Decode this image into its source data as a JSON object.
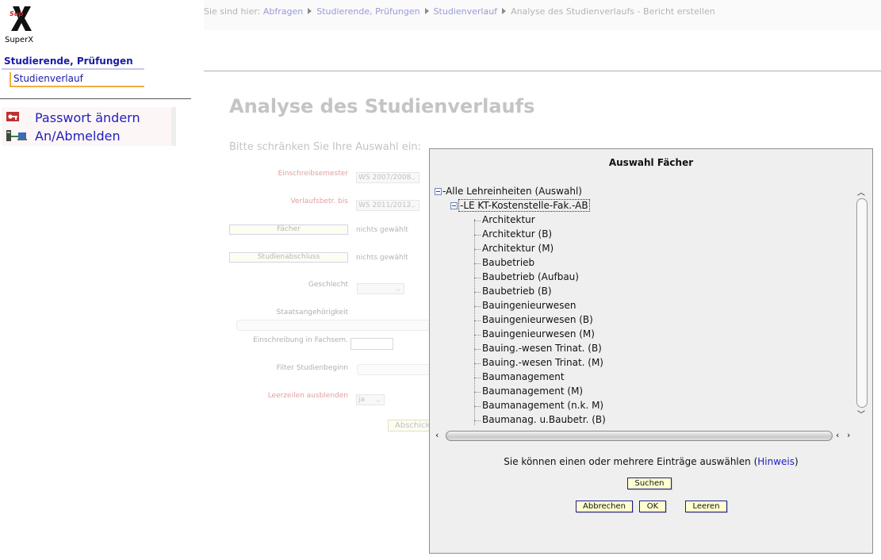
{
  "app": {
    "logo_text": "SuperX",
    "colors": {
      "link": "#1f1fbf",
      "nav_accent": "#f0b040",
      "dialog_bg": "#efefef",
      "button_bg": "#ffffd0"
    }
  },
  "sidebar": {
    "section_label": "Studierende, Prüfungen",
    "item_label": "Studienverlauf",
    "links": [
      {
        "label": "Passwort ändern",
        "icon": "key-icon"
      },
      {
        "label": "An/Abmelden",
        "icon": "network-login-icon"
      }
    ]
  },
  "header": {
    "breadcrumb_prefix": "Sie sind hier:",
    "breadcrumb": [
      "Abfragen",
      "Studierende, Prüfungen",
      "Studienverlauf"
    ],
    "breadcrumb_current": "Analyse des Studienverlaufs - Bericht erstellen"
  },
  "page": {
    "title": "Analyse des Studienverlaufs",
    "intro": "Bitte schränken Sie Ihre Auswahl ein:"
  },
  "form": {
    "einschreibsemester": {
      "label": "Einschreibsemester",
      "value": "WS 2007/2008"
    },
    "verlaufsbetr": {
      "label": "Verlaufsbetr. bis",
      "value": "WS 2011/2012"
    },
    "faecher": {
      "button": "Fächer",
      "value": "nichts gewählt"
    },
    "studienabschluss": {
      "button": "Studienabschluss",
      "value": "nichts gewählt"
    },
    "geschlecht": {
      "label": "Geschlecht",
      "value": ""
    },
    "staatsangehoerigkeit": {
      "label": "Staatsangehörigkeit"
    },
    "einschreibung_fachsem": {
      "label": "Einschreibung in Fachsem.",
      "value": ""
    },
    "filter_studienbeginn": {
      "label": "Filter Studienbeginn"
    },
    "leerzeilen": {
      "label": "Leerzeilen ausblenden",
      "value": "ja"
    },
    "submit_label": "Abschicken"
  },
  "dialog": {
    "title": "Auswahl Fächer",
    "tree": {
      "root": "Alle Lehreinheiten (Auswahl)",
      "child": "LE KT-Kostenstelle-Fak.-AB",
      "items": [
        "Architektur",
        "Architektur (B)",
        "Architektur (M)",
        "Baubetrieb",
        "Baubetrieb (Aufbau)",
        "Baubetrieb (B)",
        "Bauingenieurwesen",
        "Bauingenieurwesen (B)",
        "Bauingenieurwesen (M)",
        "Bauing.-wesen Trinat. (B)",
        "Bauing.-wesen Trinat. (M)",
        "Baumanagement",
        "Baumanagement (M)",
        "Baumanagement (n.k. M)",
        "Baumanag. u.Baubetr. (B)"
      ]
    },
    "hint_text": "Sie können einen oder mehrere Einträge auswählen",
    "hint_link": "Hinweis",
    "buttons": {
      "search": "Suchen",
      "cancel": "Abbrechen",
      "ok": "OK",
      "clear": "Leeren"
    }
  }
}
